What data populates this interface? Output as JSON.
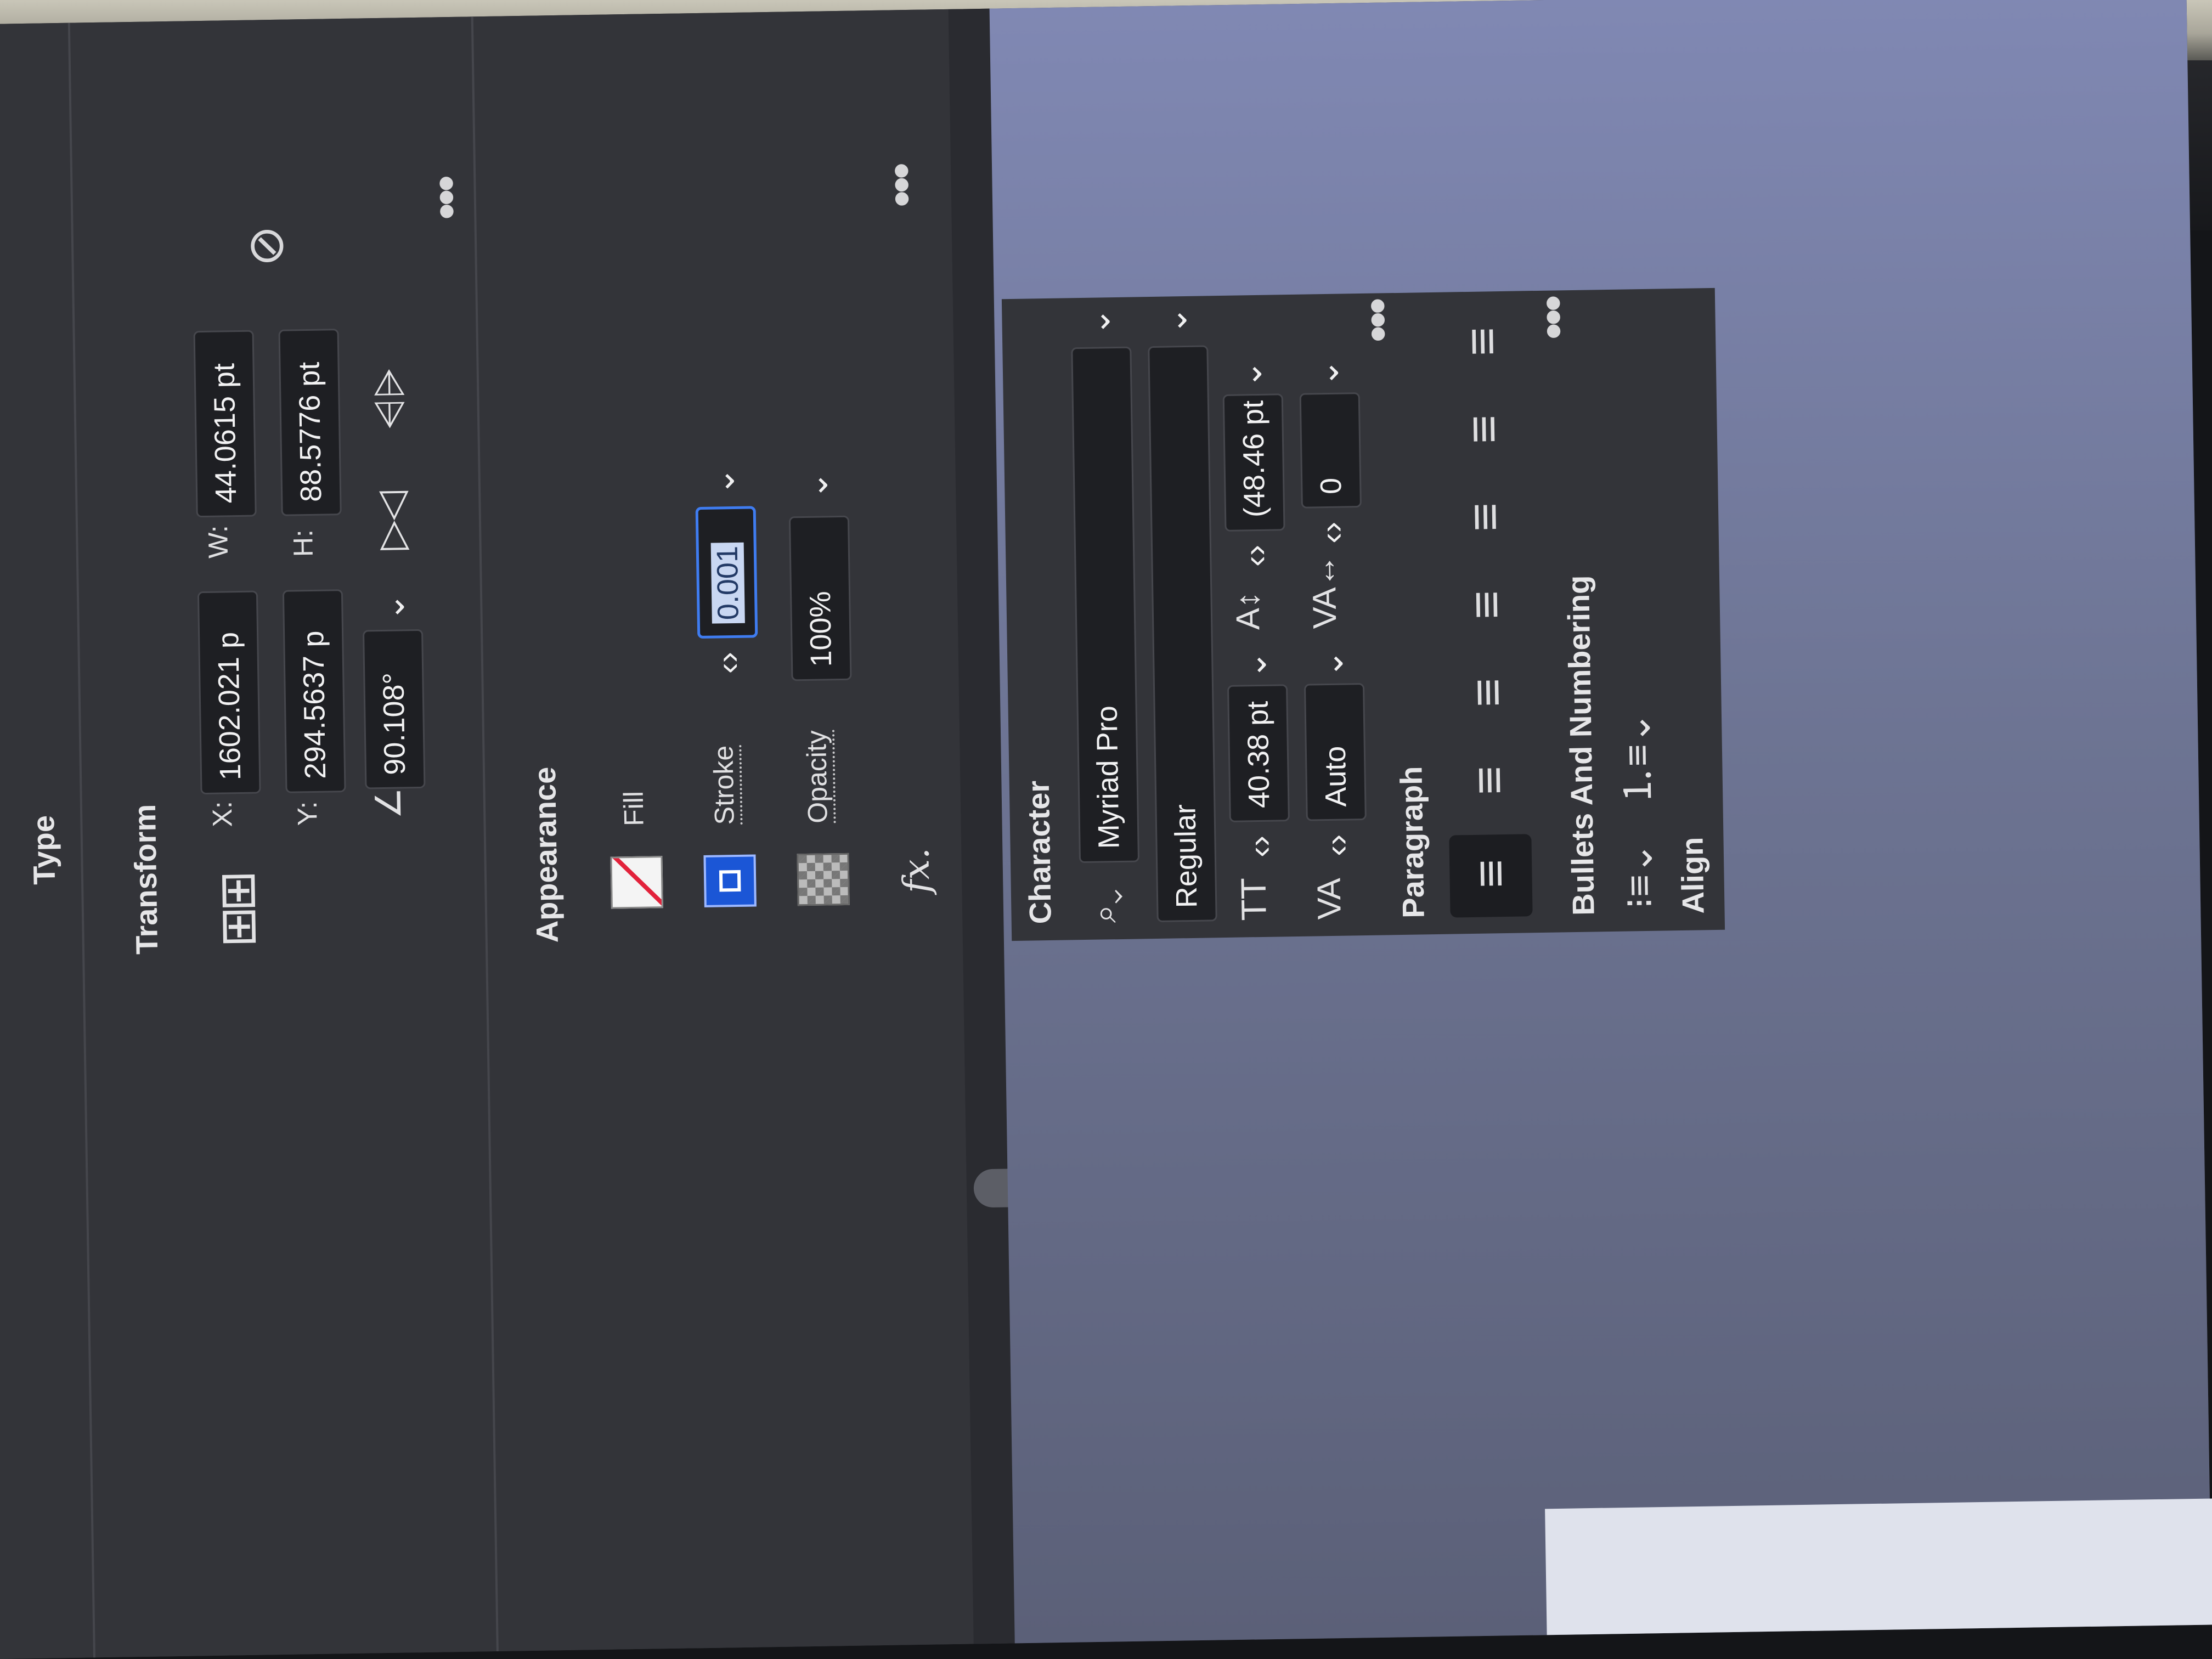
{
  "window": {
    "tab_title": "Type"
  },
  "transform": {
    "title": "Transform",
    "x_label": "X:",
    "x_value": "1602.021 p",
    "y_label": "Y:",
    "y_value": "294.5637 p",
    "w_label": "W:",
    "w_value": "44.0615 pt",
    "h_label": "H:",
    "h_value": "88.5776 pt",
    "rotate_value": "90.108°"
  },
  "appearance": {
    "title": "Appearance",
    "fill_label": "Fill",
    "stroke_label": "Stroke",
    "stroke_value": "0.001",
    "opacity_label": "Opacity",
    "opacity_value": "100%",
    "fx_label": "fx."
  },
  "character": {
    "title": "Character",
    "font_family": "Myriad Pro",
    "font_style": "Regular",
    "font_size": "40.38 pt",
    "leading": "(48.46 pt",
    "kerning": "Auto",
    "tracking": "0"
  },
  "paragraph": {
    "title": "Paragraph"
  },
  "bullets": {
    "title": "Bullets And Numbering"
  },
  "align": {
    "title": "Align"
  },
  "colors": {
    "panel_bg": "#333439",
    "field_bg": "#1e1f23",
    "accent_blue": "#3f7cf0",
    "canvas_bg": "#6d7493"
  }
}
